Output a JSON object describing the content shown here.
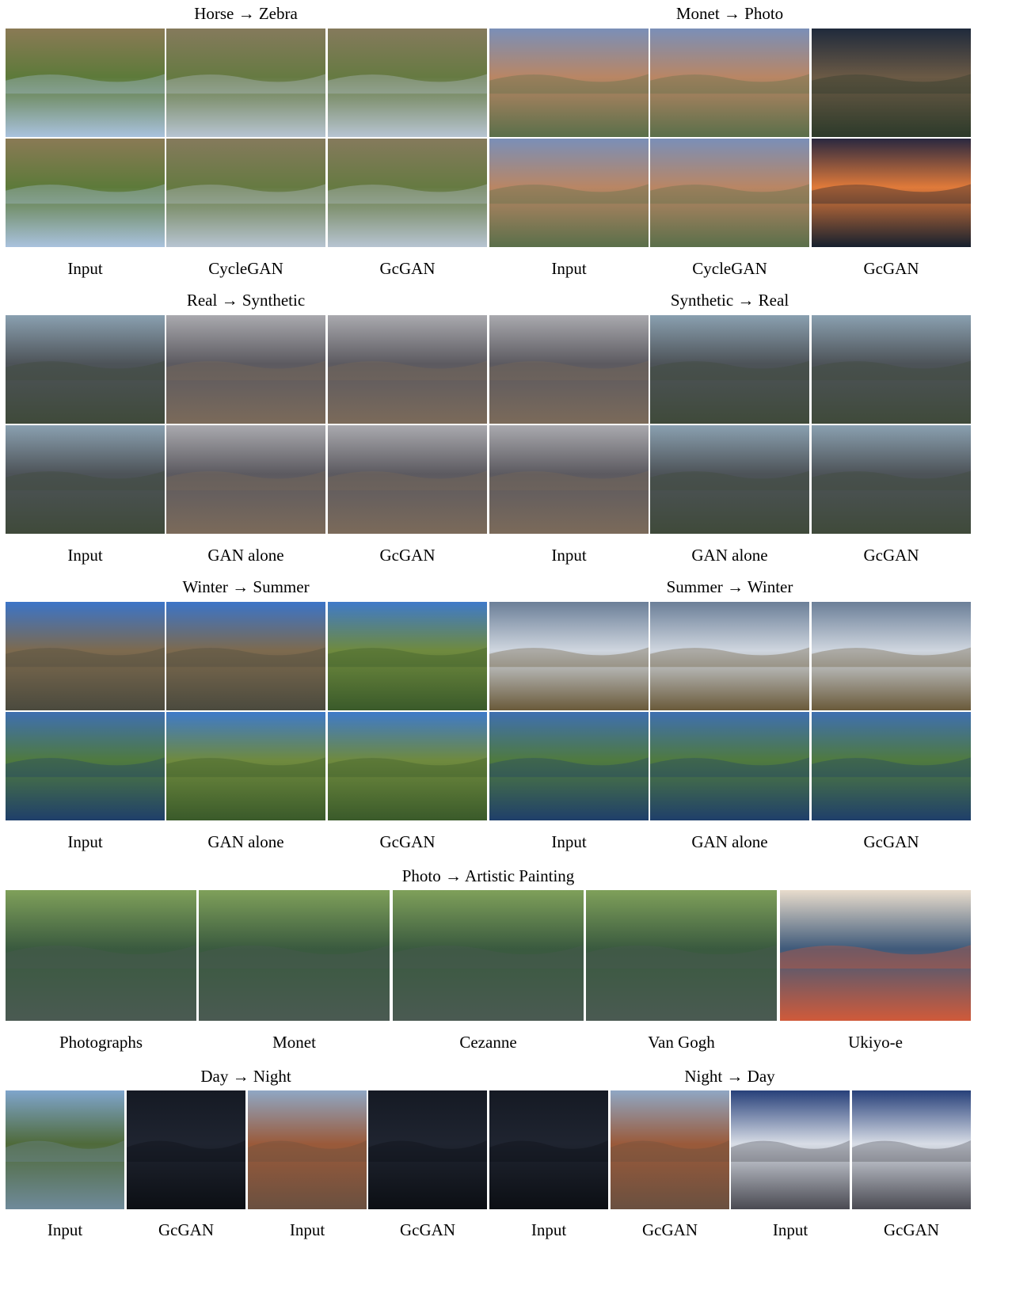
{
  "sections": {
    "horse_zebra": {
      "title": "Horse → Zebra",
      "labels": [
        "Input",
        "CycleGAN",
        "GcGAN"
      ]
    },
    "monet_photo": {
      "title": "Monet → Photo",
      "labels": [
        "Input",
        "CycleGAN",
        "GcGAN"
      ]
    },
    "real_synthetic": {
      "title": "Real → Synthetic",
      "labels": [
        "Input",
        "GAN alone",
        "GcGAN"
      ]
    },
    "synthetic_real": {
      "title": "Synthetic → Real",
      "labels": [
        "Input",
        "GAN alone",
        "GcGAN"
      ]
    },
    "winter_summer": {
      "title": "Winter → Summer",
      "labels": [
        "Input",
        "GAN alone",
        "GcGAN"
      ]
    },
    "summer_winter": {
      "title": "Summer → Winter",
      "labels": [
        "Input",
        "GAN alone",
        "GcGAN"
      ]
    },
    "photo_painting": {
      "title": "Photo → Artistic Painting",
      "labels": [
        "Photographs",
        "Monet",
        "Cezanne",
        "Van Gogh",
        "Ukiyo-e"
      ]
    },
    "day_night": {
      "title": "Day → Night",
      "labels": [
        "Input",
        "GcGAN",
        "Input",
        "GcGAN"
      ]
    },
    "night_day": {
      "title": "Night → Day",
      "labels": [
        "Input",
        "GcGAN",
        "Input",
        "GcGAN"
      ]
    }
  },
  "palette": {
    "horse": [
      "#8a7a55",
      "#5d7a3a",
      "#a9c2de"
    ],
    "zebra": [
      "#857a5c",
      "#667a42",
      "#b7c4d2"
    ],
    "monet": [
      "#7a8fb8",
      "#b98664",
      "#5a6f4a"
    ],
    "photo_dark": [
      "#1f2a3c",
      "#6b5a45",
      "#2c3a2a"
    ],
    "sunset": [
      "#2a2840",
      "#e07a3a",
      "#16202e"
    ],
    "street_real": [
      "#8aa0b0",
      "#4d5358",
      "#3f4a3a"
    ],
    "street_syn": [
      "#a9a9ae",
      "#5c5a60",
      "#7b6a5a"
    ],
    "winter": [
      "#3b74c8",
      "#7d6a4e",
      "#4b4a3e"
    ],
    "summer": [
      "#3f7ac9",
      "#6f8a3e",
      "#3a5a2a"
    ],
    "snow": [
      "#6b7f98",
      "#cfd6df",
      "#6a5a3a"
    ],
    "yosemite": [
      "#3f6fb0",
      "#4f7a3f",
      "#1f3f6a"
    ],
    "forest": [
      "#7fa05a",
      "#3a5a3f",
      "#4a5a52"
    ],
    "ukiyo": [
      "#e8dccc",
      "#3f5a7a",
      "#d05a3a"
    ],
    "day": [
      "#7fa5cc",
      "#4f6a3a",
      "#6f8a9a"
    ],
    "night": [
      "#151a24",
      "#1f2430",
      "#0c0f14"
    ],
    "town": [
      "#8fa7c4",
      "#9a5a3a",
      "#6a5040"
    ],
    "snowstreet": [
      "#27407a",
      "#d8dde6",
      "#4a4a52"
    ]
  }
}
